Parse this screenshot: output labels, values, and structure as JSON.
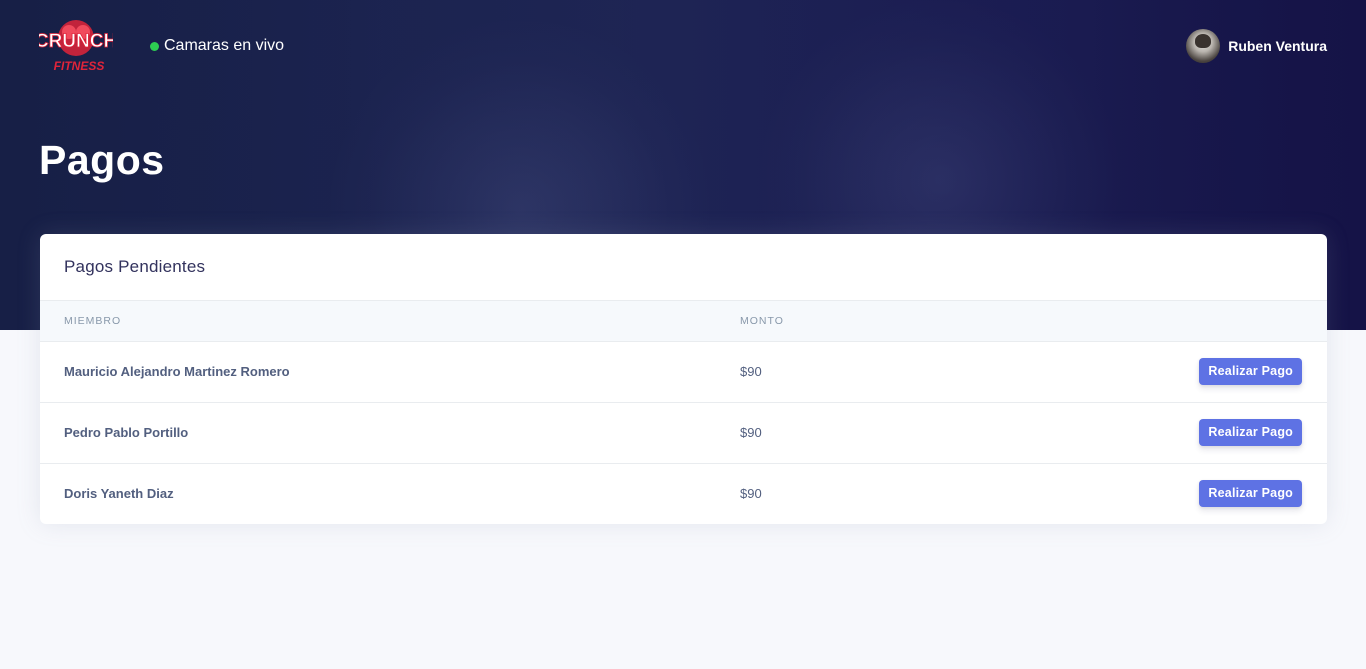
{
  "header": {
    "logo": {
      "text_top": "CRUNCH",
      "text_bottom": "FITNESS"
    },
    "live_link": {
      "label": "Camaras en vivo",
      "status_color": "#2dce52"
    },
    "user": {
      "name": "Ruben Ventura"
    }
  },
  "page": {
    "title": "Pagos"
  },
  "card": {
    "title": "Pagos Pendientes",
    "columns": {
      "member": "MIEMBRO",
      "amount": "MONTO"
    },
    "rows": [
      {
        "member": "Mauricio Alejandro Martinez Romero",
        "amount": "$90",
        "action": "Realizar Pago"
      },
      {
        "member": "Pedro Pablo Portillo",
        "amount": "$90",
        "action": "Realizar Pago"
      },
      {
        "member": "Doris Yaneth Diaz",
        "amount": "$90",
        "action": "Realizar Pago"
      }
    ]
  },
  "colors": {
    "hero": "#1e2554",
    "primary_button": "#5e72e4",
    "heading": "#32325d",
    "muted": "#8898aa",
    "body_text": "#525f7f",
    "brand_red": "#e0243a"
  }
}
